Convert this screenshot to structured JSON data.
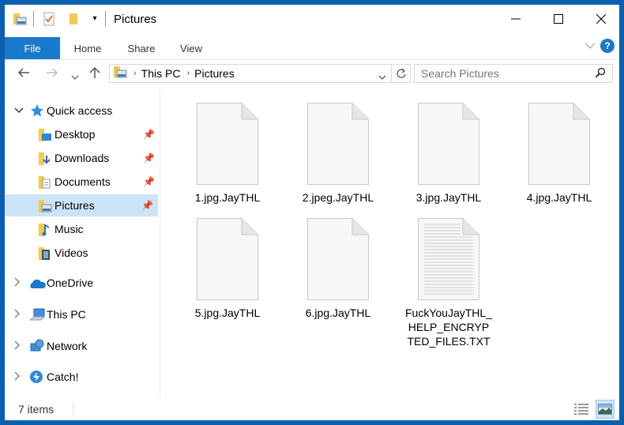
{
  "window": {
    "title": "Pictures"
  },
  "ribbon": {
    "tabs": [
      "File",
      "Home",
      "Share",
      "View"
    ]
  },
  "address": {
    "crumbs": [
      "This PC",
      "Pictures"
    ],
    "search_placeholder": "Search Pictures"
  },
  "sidebar": {
    "quick_access": "Quick access",
    "quick_items": [
      {
        "label": "Desktop",
        "pinned": true
      },
      {
        "label": "Downloads",
        "pinned": true
      },
      {
        "label": "Documents",
        "pinned": true
      },
      {
        "label": "Pictures",
        "pinned": true,
        "selected": true
      },
      {
        "label": "Music",
        "pinned": false
      },
      {
        "label": "Videos",
        "pinned": false
      }
    ],
    "roots": [
      "OneDrive",
      "This PC",
      "Network",
      "Catch!"
    ]
  },
  "files": [
    {
      "name": "1.jpg.JayTHL",
      "type": "blank"
    },
    {
      "name": "2.jpeg.JayTHL",
      "type": "blank"
    },
    {
      "name": "3.jpg.JayTHL",
      "type": "blank"
    },
    {
      "name": "4.jpg.JayTHL",
      "type": "blank"
    },
    {
      "name": "5.jpg.JayTHL",
      "type": "blank"
    },
    {
      "name": "6.jpg.JayTHL",
      "type": "blank"
    },
    {
      "name": "FuckYouJayTHL_HELP_ENCRYPTED_FILES.TXT",
      "type": "text"
    }
  ],
  "status": {
    "count": "7 items"
  },
  "colors": {
    "accent": "#1979ca",
    "selection": "#cce4f7",
    "border": "#0a5fb0"
  }
}
